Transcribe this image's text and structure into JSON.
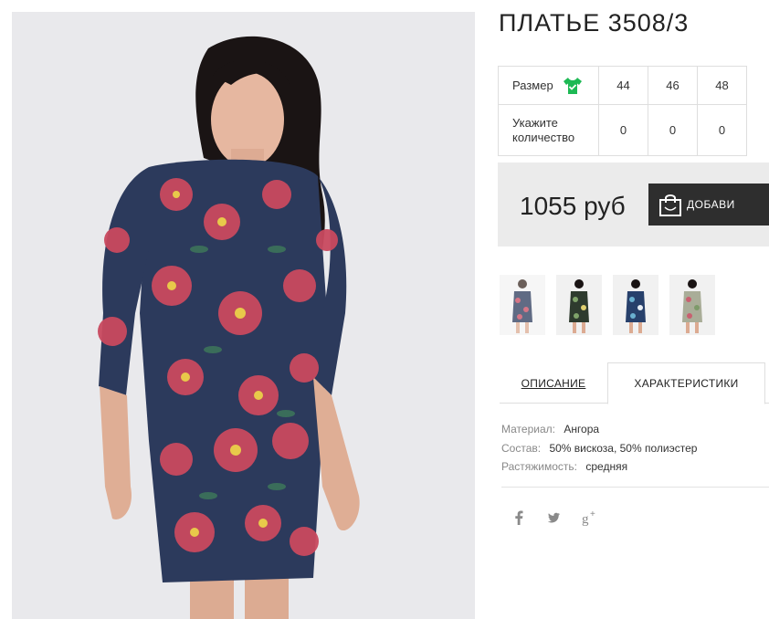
{
  "product": {
    "title": "ПЛАТЬЕ 3508/3",
    "photo_alt": "dress photo"
  },
  "size_table": {
    "size_label": "Размер",
    "qty_label_line1": "Укажите",
    "qty_label_line2": "количество",
    "sizes": [
      "44",
      "46",
      "48"
    ],
    "quantities": [
      "0",
      "0",
      "0"
    ]
  },
  "purchase": {
    "price": "1055 руб",
    "add_button_label": "ДОБАВИ"
  },
  "tabs": {
    "description": "ОПИСАНИЕ",
    "characteristics": "ХАРАКТЕРИСТИКИ"
  },
  "specs": [
    {
      "key": "Материал:",
      "value": "Ангора"
    },
    {
      "key": "Состав:",
      "value": "50% вискоза, 50% полиэстер"
    },
    {
      "key": "Растяжимость:",
      "value": "средняя"
    }
  ],
  "social": {
    "facebook": "f",
    "twitter": "twitter-icon",
    "googleplus": "g+"
  },
  "colors": {
    "accent_green": "#1db954",
    "button_dark": "#2e2e2e",
    "price_box_bg": "#ebebeb",
    "dress_navy": "#2c3a5c",
    "flower_red": "#c9495f"
  }
}
